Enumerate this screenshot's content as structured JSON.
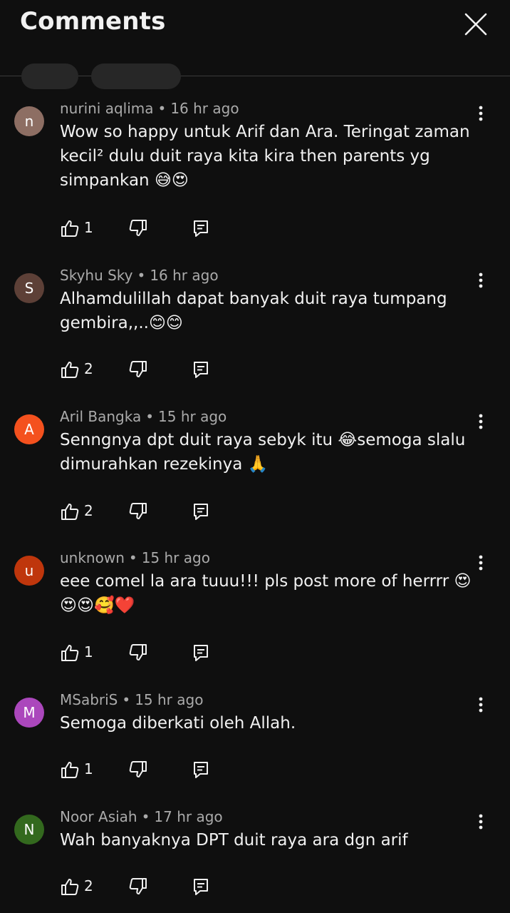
{
  "header": {
    "title": "Comments"
  },
  "comments": [
    {
      "avatar_letter": "n",
      "avatar_color": "#8d6e63",
      "author": "nurini aqlima",
      "time": "16 hr ago",
      "text": "Wow so happy untuk Arif dan Ara. Teringat zaman kecil² dulu duit raya kita kira then parents yg simpankan 😅😍",
      "likes": "1"
    },
    {
      "avatar_letter": "S",
      "avatar_color": "#5d4037",
      "author": "Skyhu Sky",
      "time": "16 hr ago",
      "text": "Alhamdulillah dapat banyak duit raya tumpang gembira,,..😊😊",
      "likes": "2"
    },
    {
      "avatar_letter": "A",
      "avatar_color": "#f4511e",
      "author": "Aril Bangka",
      "time": "15 hr ago",
      "text": "Senngnya dpt duit raya sebyk itu 😂semoga slalu dimurahkan rezekinya 🙏",
      "likes": "2"
    },
    {
      "avatar_letter": "u",
      "avatar_color": "#bf360c",
      "author": "unknown",
      "time": "15 hr ago",
      "text": "eee comel la ara tuuu!!! pls post more of herrrr 😍😍😍🥰❤️",
      "likes": "1"
    },
    {
      "avatar_letter": "M",
      "avatar_color": "#ab47bc",
      "author": "MSabriS",
      "time": "15 hr ago",
      "text": "Semoga diberkati oleh Allah.",
      "likes": "1"
    },
    {
      "avatar_letter": "N",
      "avatar_color": "#33691e",
      "author": "Noor Asiah",
      "time": "17 hr ago",
      "text": "Wah banyaknya DPT duit raya ara dgn arif",
      "likes": "2"
    }
  ]
}
